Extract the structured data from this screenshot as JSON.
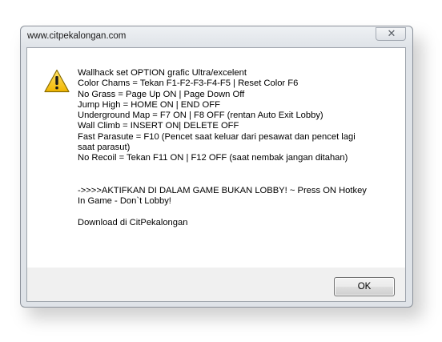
{
  "window": {
    "title": "www.citpekalongan.com",
    "close_symbol": "✕"
  },
  "dialog": {
    "icon": "warning-icon",
    "lines": [
      "Wallhack set OPTION grafic Ultra/excelent",
      "Color Chams = Tekan F1-F2-F3-F4-F5 | Reset Color F6",
      "No Grass = Page Up ON | Page Down Off",
      "Jump High = HOME ON | END OFF",
      "Underground Map = F7 ON | F8 OFF (rentan Auto Exit Lobby)",
      "Wall Climb = INSERT ON| DELETE OFF",
      "Fast Parasute = F10 (Pencet saat keluar dari pesawat dan pencet lagi",
      "saat parasut)",
      "No Recoil = Tekan F11 ON | F12 OFF (saat nembak jangan ditahan)"
    ],
    "notice_lines": [
      "->>>>AKTIFKAN DI DALAM GAME BUKAN LOBBY! ~ Press ON Hotkey",
      "In Game - Don`t Lobby!"
    ],
    "download_text": "Download di CitPekalongan",
    "ok_label": "OK"
  },
  "colors": {
    "warning_fill": "#f5c518",
    "warning_border": "#8a6d00",
    "frame": "#dfe3e8"
  }
}
